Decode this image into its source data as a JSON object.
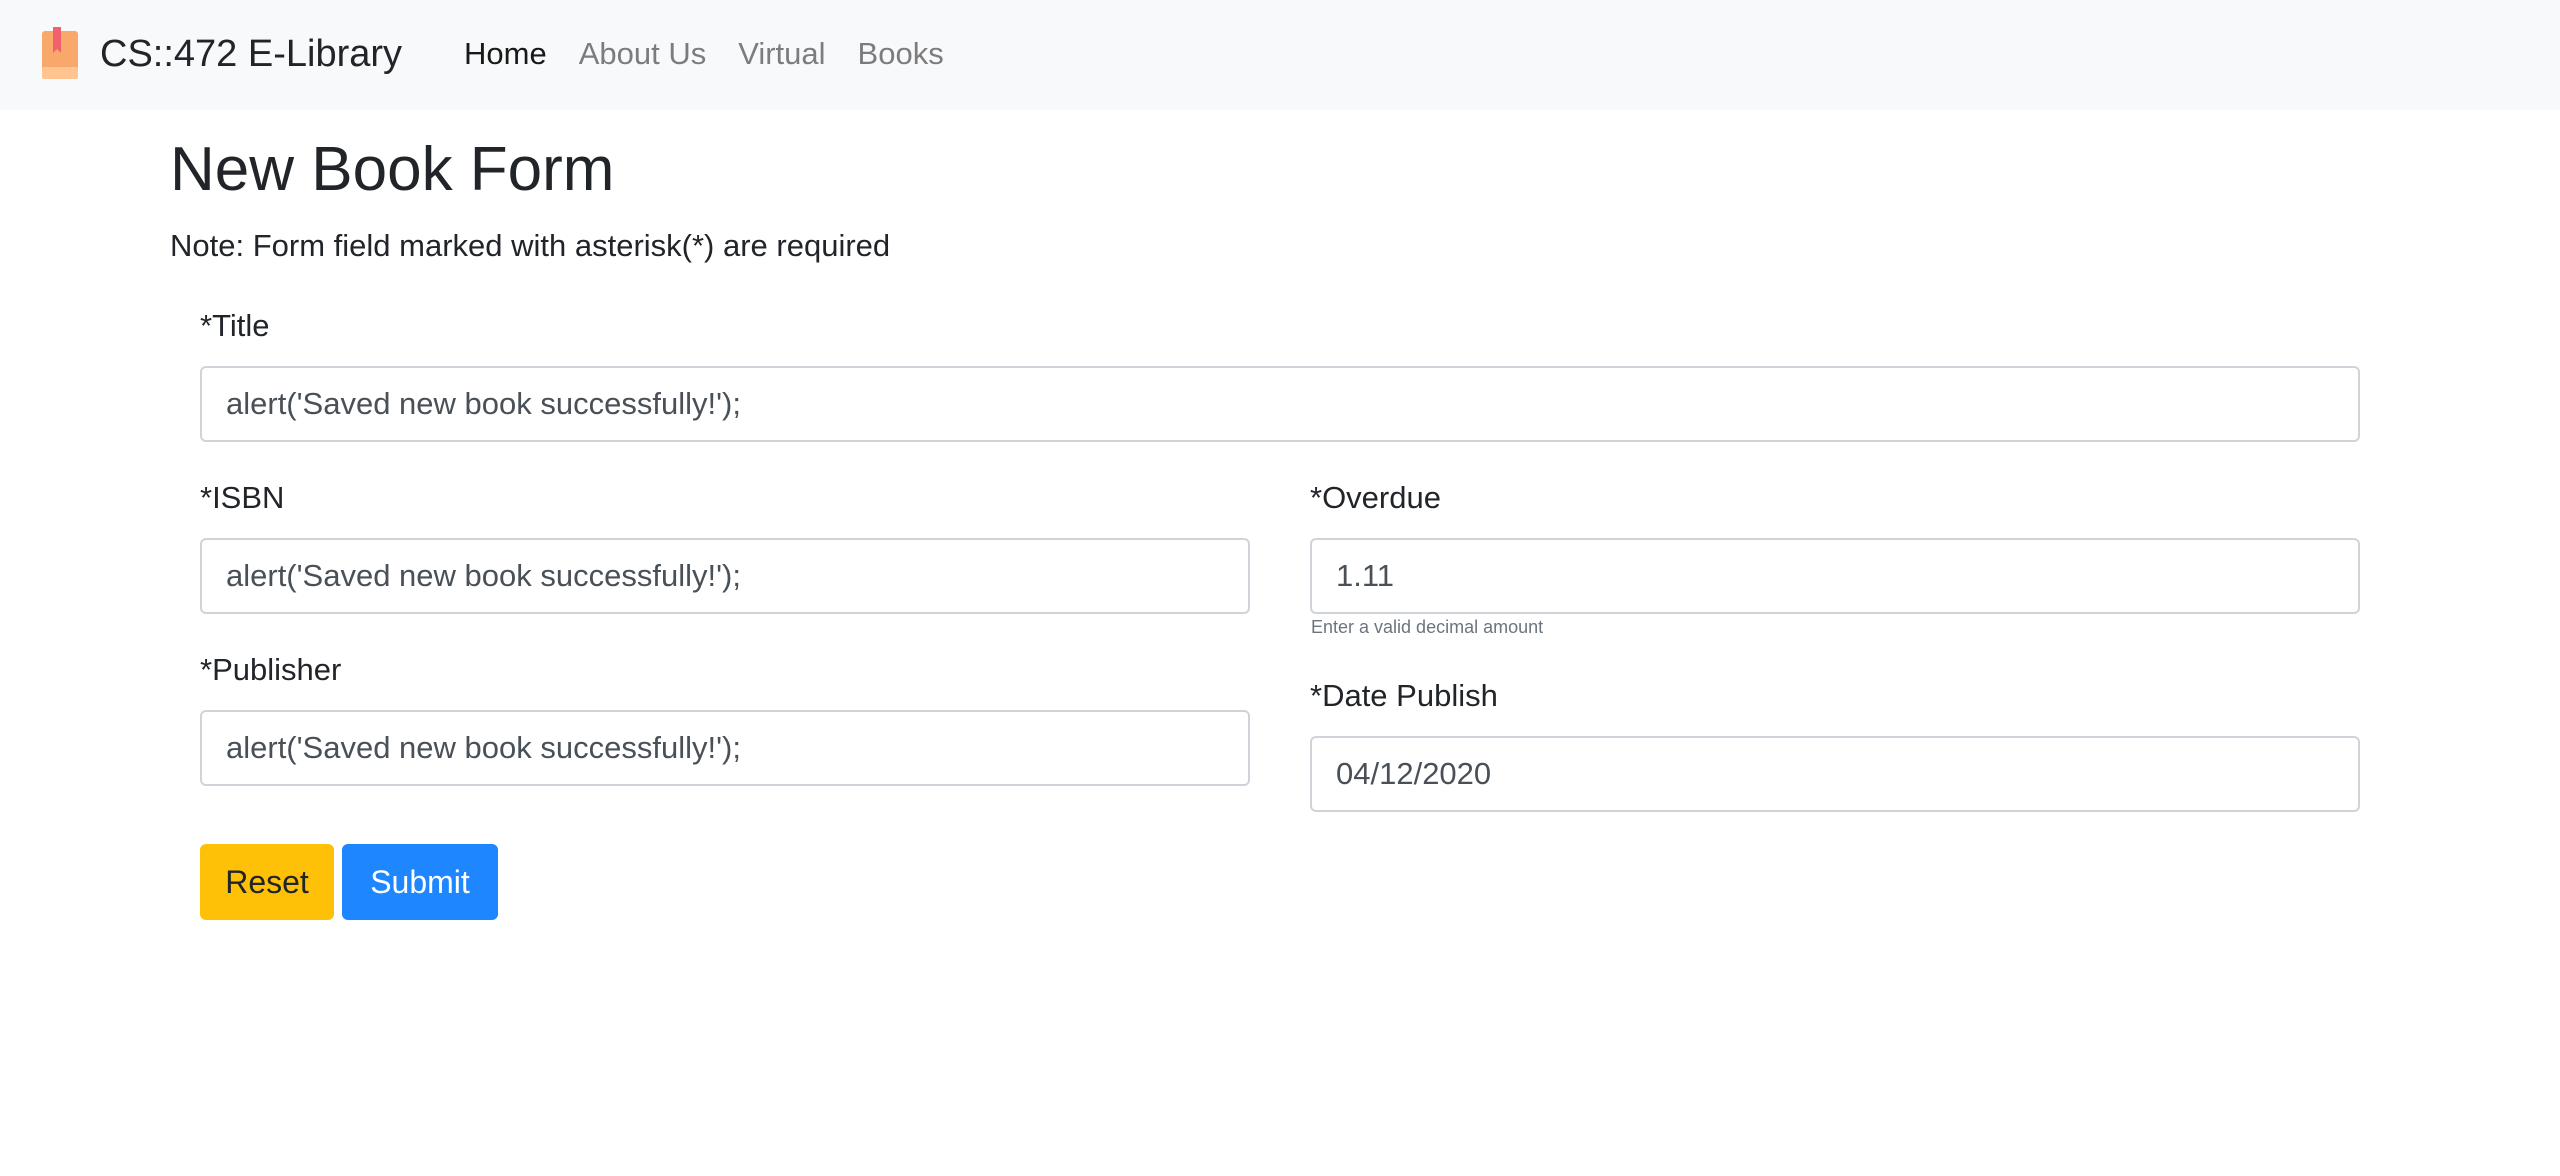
{
  "navbar": {
    "brand_icon": "book-icon",
    "brand_text": "CS::472 E-Library",
    "links": [
      {
        "label": "Home",
        "active": true
      },
      {
        "label": "About Us",
        "active": false
      },
      {
        "label": "Virtual",
        "active": false
      },
      {
        "label": "Books",
        "active": false
      }
    ]
  },
  "page": {
    "title": "New Book Form",
    "note": "Note: Form field marked with asterisk(*) are required"
  },
  "form": {
    "title": {
      "label": "*Title",
      "value": "alert('Saved new book successfully!');"
    },
    "isbn": {
      "label": "*ISBN",
      "value": "alert('Saved new book successfully!');"
    },
    "overdue": {
      "label": "*Overdue",
      "value": "1.11",
      "help": "Enter a valid decimal amount"
    },
    "publisher": {
      "label": "*Publisher",
      "value": "alert('Saved new book successfully!');"
    },
    "date_publish": {
      "label": "*Date Publish",
      "value": "04/12/2020"
    }
  },
  "buttons": {
    "reset": "Reset",
    "submit": "Submit"
  },
  "colors": {
    "navbar_bg": "#f8f9fa",
    "reset_button": "#ffc107",
    "submit_button": "#1e87ff"
  }
}
